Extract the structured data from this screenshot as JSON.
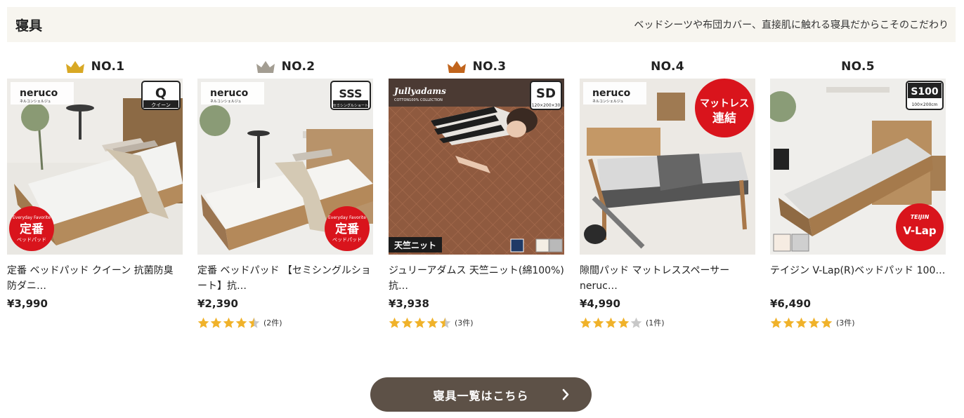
{
  "section": {
    "title": "寝具",
    "subtitle": "ベッドシーツや布団カバー、直接肌に触れる寝具だからこそのこだわり"
  },
  "colors": {
    "gold": "#d8a824",
    "silver": "#a39d92",
    "bronze": "#c1641c",
    "star": "#f0b22a",
    "star_empty": "#c8c8c8",
    "button": "#5d5147",
    "header_band": "#f7f5ef"
  },
  "products": [
    {
      "rank": "NO.1",
      "crown": "gold-crown-icon",
      "name": "定番 ベッドパッド クイーン 抗菌防臭防ダニ…",
      "price": "¥3,990",
      "image": {
        "brand": "neruco",
        "brand_sub": "ネルコンシェルジュ",
        "size_code": "Q",
        "size_label": "クイーン",
        "badge_top": "Everyday Favorite",
        "badge_main": "定番",
        "badge_bottom": "ベッドパッド"
      },
      "rating": null,
      "review_count": ""
    },
    {
      "rank": "NO.2",
      "crown": "silver-crown-icon",
      "name": "定番 ベッドパッド 【セミシングルショート】抗…",
      "price": "¥2,390",
      "image": {
        "brand": "neruco",
        "brand_sub": "ネルコンシェルジュ",
        "size_code": "SSS",
        "size_label": "セミシングルショート",
        "badge_top": "Everyday Favorite",
        "badge_main": "定番",
        "badge_bottom": "ベッドパッド"
      },
      "rating": 4.5,
      "review_count": "(2件)"
    },
    {
      "rank": "NO.3",
      "crown": "bronze-crown-icon",
      "name": "ジュリーアダムス 天竺ニット(綿100%) 抗…",
      "price": "¥3,938",
      "image": {
        "brand": "Jullyadams",
        "brand_sub": "COTTON100% COLLECTION",
        "size_code": "SD",
        "size_label": "120×200×30",
        "tag": "天竺ニット"
      },
      "rating": 4.5,
      "review_count": "(3件)"
    },
    {
      "rank": "NO.4",
      "crown": "",
      "name": "隙間パッド マットレススペーサー neruc…",
      "price": "¥4,990",
      "image": {
        "brand": "neruco",
        "brand_sub": "ネルコンシェルジュ",
        "badge_line1": "マットレス",
        "badge_line2": "連結"
      },
      "rating": 4,
      "review_count": "(1件)"
    },
    {
      "rank": "NO.5",
      "crown": "",
      "name": "テイジン V-Lap(R)ベッドパッド 100…",
      "price": "¥6,490",
      "image": {
        "size_code": "S100",
        "size_label": "100×200cm",
        "badge_top": "TEIJIN",
        "badge_main": "V-Lap"
      },
      "rating": 5,
      "review_count": "(3件)"
    }
  ],
  "more_button": {
    "label": "寝具一覧はこちら"
  }
}
